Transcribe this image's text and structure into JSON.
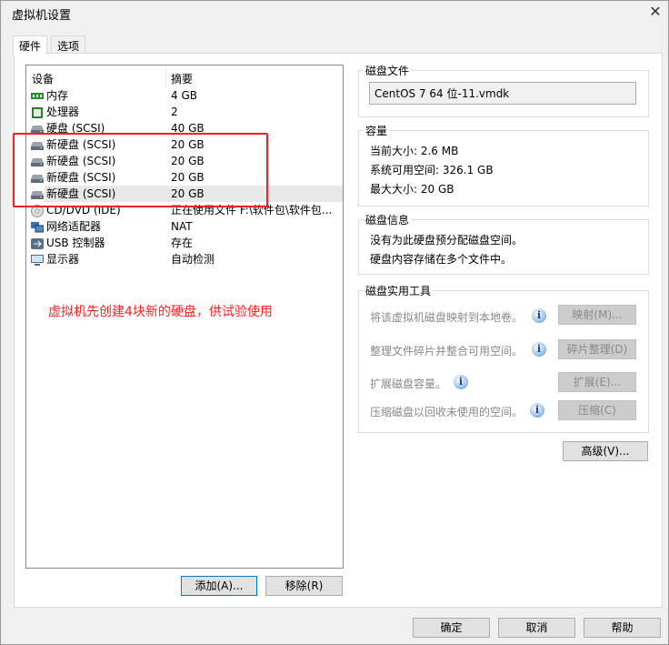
{
  "window": {
    "title": "虚拟机设置",
    "close": "✕"
  },
  "tabs": [
    {
      "label": "硬件",
      "active": true
    },
    {
      "label": "选项",
      "active": false
    }
  ],
  "devices": {
    "headers": {
      "device": "设备",
      "summary": "摘要"
    },
    "rows": [
      {
        "icon": "memory-icon",
        "name": "内存",
        "summary": "4 GB"
      },
      {
        "icon": "processor-icon",
        "name": "处理器",
        "summary": "2"
      },
      {
        "icon": "hard-disk-icon",
        "name": "硬盘 (SCSI)",
        "summary": "40 GB"
      },
      {
        "icon": "hard-disk-icon",
        "name": "新硬盘 (SCSI)",
        "summary": "20 GB"
      },
      {
        "icon": "hard-disk-icon",
        "name": "新硬盘 (SCSI)",
        "summary": "20 GB"
      },
      {
        "icon": "hard-disk-icon",
        "name": "新硬盘 (SCSI)",
        "summary": "20 GB"
      },
      {
        "icon": "hard-disk-icon",
        "name": "新硬盘 (SCSI)",
        "summary": "20 GB",
        "selected": true
      },
      {
        "icon": "cd-dvd-icon",
        "name": "CD/DVD (IDE)",
        "summary": "正在使用文件 F:\\软件包\\软件包..."
      },
      {
        "icon": "network-adapter-icon",
        "name": "网络适配器",
        "summary": "NAT"
      },
      {
        "icon": "usb-icon",
        "name": "USB 控制器",
        "summary": "存在"
      },
      {
        "icon": "display-icon",
        "name": "显示器",
        "summary": "自动检测"
      }
    ],
    "add_button": "添加(A)...",
    "remove_button": "移除(R)"
  },
  "annotation": "虚拟机先创建4块新的硬盘，供试验使用",
  "disk_file": {
    "label": "磁盘文件",
    "value": "CentOS 7 64 位-11.vmdk"
  },
  "capacity": {
    "label": "容量",
    "current": "当前大小: 2.6 MB",
    "available": "系统可用空间: 326.1 GB",
    "max": "最大大小: 20 GB"
  },
  "disk_info": {
    "label": "磁盘信息",
    "line1": "没有为此硬盘预分配磁盘空间。",
    "line2": "硬盘内容存储在多个文件中。"
  },
  "utilities": {
    "label": "磁盘实用工具",
    "items": [
      {
        "text": "将该虚拟机磁盘映射到本地卷。",
        "button": "映射(M)..."
      },
      {
        "text": "整理文件碎片并整合可用空间。",
        "button": "碎片整理(D)"
      },
      {
        "text": "扩展磁盘容量。",
        "button": "扩展(E)..."
      },
      {
        "text": "压缩磁盘以回收未使用的空间。",
        "button": "压缩(C)"
      }
    ]
  },
  "advanced_button": "高级(V)...",
  "footer": {
    "ok": "确定",
    "cancel": "取消",
    "help": "帮助"
  },
  "colors": {
    "annotation": "#ff2020",
    "highlight_box": "#f02020"
  }
}
